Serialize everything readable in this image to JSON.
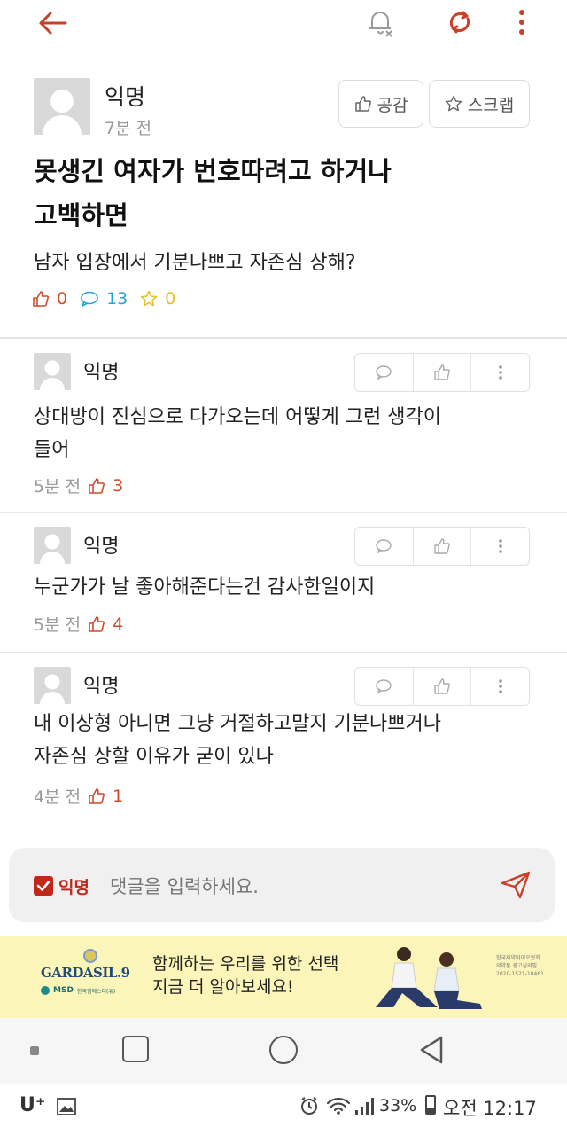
{
  "post": {
    "author": "익명",
    "time": "7분 전",
    "empathy_label": "공감",
    "scrap_label": "스크랩",
    "title_line1": "못생긴 여자가 번호따려고 하거나",
    "title_line2": "고백하면",
    "body": "남자 입장에서 기분나쁘고 자존심 상해?",
    "likes": "0",
    "comments": "13",
    "scraps": "0"
  },
  "comments": [
    {
      "author": "익명",
      "line1": "상대방이 진심으로 다가오는데 어떻게 그런 생각이",
      "line2": "들어",
      "time": "5분 전",
      "likes": "3"
    },
    {
      "author": "익명",
      "line1": "누군가가 날 좋아해준다는건 감사한일이지",
      "line2": "",
      "time": "5분 전",
      "likes": "4"
    },
    {
      "author": "익명",
      "line1": "내 이상형 아니면 그냥 거절하고말지 기분나쁘거나",
      "line2": "자존심 상할 이유가 굳이 있나",
      "time": "4분 전",
      "likes": "1"
    }
  ],
  "input": {
    "anon_label": "익명",
    "placeholder": "댓글을 입력하세요."
  },
  "ad": {
    "brand": "GARDASIL.9",
    "brand_sub": "MSD",
    "brand_sub2": "한국엠에스디(유)",
    "headline1": "함께하는 우리를 위한 선택",
    "headline2": "지금 더 알아보세요!",
    "fine1": "한국제약바이오협회",
    "fine2": "의약품 광고심의필",
    "fine3": "2020-1521-10461"
  },
  "status": {
    "carrier": "U⁺",
    "battery": "33%",
    "clock": "오전 12:17"
  },
  "colors": {
    "accent": "#c8402a",
    "like": "#d24a2a",
    "comment": "#2aa3d6",
    "scrap": "#e8c020",
    "checkbox": "#c0281c"
  }
}
